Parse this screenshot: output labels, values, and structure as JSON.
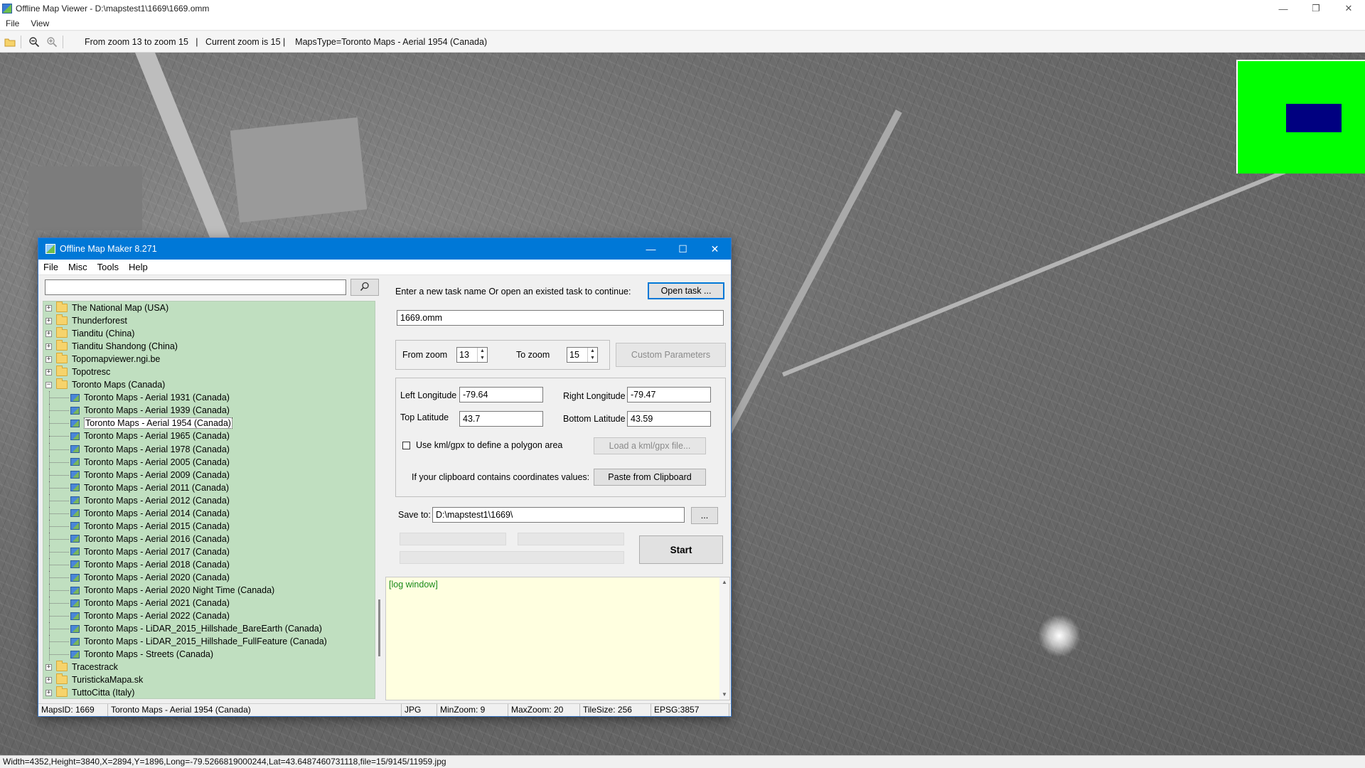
{
  "viewer": {
    "title": "Offline Map Viewer - D:\\mapstest1\\1669\\1669.omm",
    "window_controls": {
      "minimize": "—",
      "maximize": "❐",
      "close": "✕"
    },
    "menu": [
      "File",
      "View"
    ],
    "toolbar": {
      "info": "From zoom 13 to zoom 15   |   Current zoom is 15 |    MapsType=Toronto Maps - Aerial 1954 (Canada)"
    },
    "minimap_colors": {
      "background": "#00ff00",
      "viewport": "#000080"
    },
    "status": "Width=4352,Height=3840,X=2894,Y=1896,Long=-79.5266819000244,Lat=43.6487460731118,file=15/9145/11959.jpg"
  },
  "dialog": {
    "title": "Offline Map Maker 8.271",
    "window_controls": {
      "minimize": "—",
      "maximize": "☐",
      "close": "✕"
    },
    "menu": [
      "File",
      "Misc",
      "Tools",
      "Help"
    ],
    "search": {
      "value": "",
      "icon": "search-icon"
    },
    "tree": {
      "top_items": [
        "The National Map (USA)",
        "Thunderforest",
        "Tianditu (China)",
        "Tianditu Shandong (China)",
        "Topomapviewer.ngi.be",
        "Topotresc"
      ],
      "expanded_folder": "Toronto Maps (Canada)",
      "children": [
        "Toronto Maps - Aerial 1931 (Canada)",
        "Toronto Maps - Aerial 1939 (Canada)",
        "Toronto Maps - Aerial 1954 (Canada)",
        "Toronto Maps - Aerial 1965 (Canada)",
        "Toronto Maps - Aerial 1978 (Canada)",
        "Toronto Maps - Aerial 2005 (Canada)",
        "Toronto Maps - Aerial 2009 (Canada)",
        "Toronto Maps - Aerial 2011 (Canada)",
        "Toronto Maps - Aerial 2012 (Canada)",
        "Toronto Maps - Aerial 2014 (Canada)",
        "Toronto Maps - Aerial 2015 (Canada)",
        "Toronto Maps - Aerial 2016 (Canada)",
        "Toronto Maps - Aerial 2017 (Canada)",
        "Toronto Maps - Aerial 2018 (Canada)",
        "Toronto Maps - Aerial 2020 (Canada)",
        "Toronto Maps - Aerial 2020 Night Time (Canada)",
        "Toronto Maps - Aerial 2021 (Canada)",
        "Toronto Maps - Aerial 2022 (Canada)",
        "Toronto Maps - LiDAR_2015_Hillshade_BareEarth (Canada)",
        "Toronto Maps - LiDAR_2015_Hillshade_FullFeature (Canada)",
        "Toronto Maps - Streets (Canada)"
      ],
      "selected": "Toronto Maps - Aerial 1954 (Canada)",
      "bottom_items": [
        "Tracestrack",
        "TuristickaMapa.sk",
        "TuttoCitta (Italy)"
      ]
    },
    "task": {
      "prompt": "Enter a new task name Or open an existed task to continue:",
      "open_button": "Open task ...",
      "task_name": "1669.omm"
    },
    "zoom": {
      "from_label": "From zoom",
      "from_value": "13",
      "to_label": "To zoom",
      "to_value": "15",
      "custom_button": "Custom Parameters"
    },
    "coords": {
      "left_lon_label": "Left Longitude",
      "left_lon": "-79.64",
      "right_lon_label": "Right Longitude",
      "right_lon": "-79.47",
      "top_lat_label": "Top Latitude",
      "top_lat": "43.7",
      "bottom_lat_label": "Bottom Latitude",
      "bottom_lat": "43.59",
      "kml_checkbox_label": "Use kml/gpx to define a polygon area",
      "kml_checked": false,
      "kml_button": "Load a kml/gpx file...",
      "clipboard_label": "If your clipboard contains coordinates values:",
      "clipboard_button": "Paste from Clipboard"
    },
    "save": {
      "label": "Save to:",
      "path": "D:\\mapstest1\\1669\\",
      "browse_button": "...",
      "start_button": "Start"
    },
    "log": {
      "text": "[log window]"
    },
    "status": {
      "maps_id": "MapsID: 1669",
      "map_name": "Toronto Maps - Aerial 1954 (Canada)",
      "format": "JPG",
      "min_zoom": "MinZoom: 9",
      "max_zoom": "MaxZoom: 20",
      "tile_size": "TileSize: 256",
      "epsg": "EPSG:3857"
    }
  }
}
